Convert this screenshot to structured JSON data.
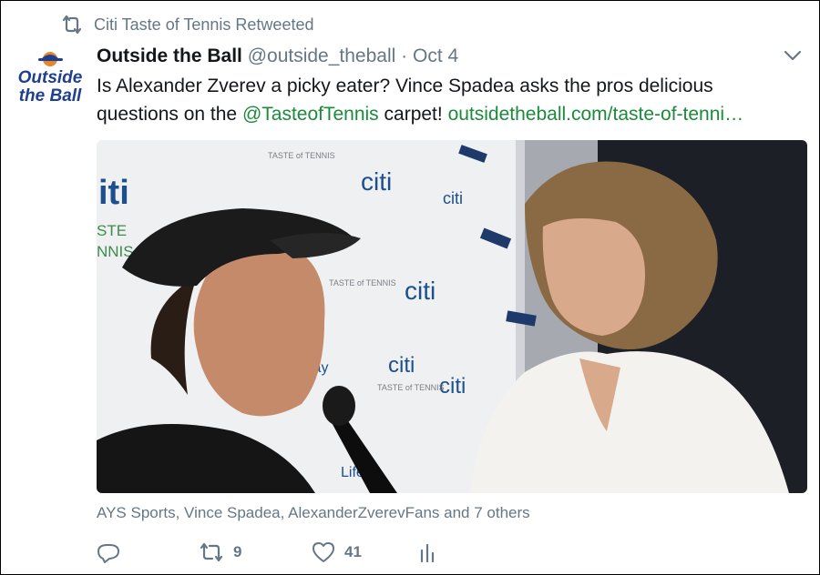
{
  "retweet_context": {
    "icon": "retweet-icon",
    "text": "Citi Taste of Tennis Retweeted"
  },
  "tweet": {
    "avatar_text_line1": "Outside",
    "avatar_text_line2": "the Ball",
    "author_name": "Outside the Ball",
    "author_handle": "@outside_theball",
    "separator": "·",
    "date": "Oct 4",
    "text_part1": "Is Alexander Zverev a picky eater? Vince Spadea asks the pros delicious questions on the ",
    "mention": "@TasteofTennis",
    "text_part2": " carpet! ",
    "link": "outsidetheball.com/taste-of-tenni…",
    "liked_by": "AYS Sports, Vince Spadea, AlexanderZverevFans and 7 others"
  },
  "media": {
    "description_icon": "photo",
    "backdrop_logo_texts": [
      "citi",
      "TASTE of TENNIS"
    ],
    "backdrop_partial_texts": [
      "iti",
      "STE",
      "NNIS",
      "lay",
      "Lifew"
    ]
  },
  "actions": {
    "reply": {
      "icon": "reply-icon",
      "count": ""
    },
    "retweet": {
      "icon": "retweet-icon",
      "count": "9"
    },
    "like": {
      "icon": "heart-icon",
      "count": "41"
    },
    "analytics": {
      "icon": "analytics-icon"
    }
  },
  "colors": {
    "secondary_text": "#657786",
    "link_green": "#1b8a3a",
    "primary_text": "#14171a"
  }
}
